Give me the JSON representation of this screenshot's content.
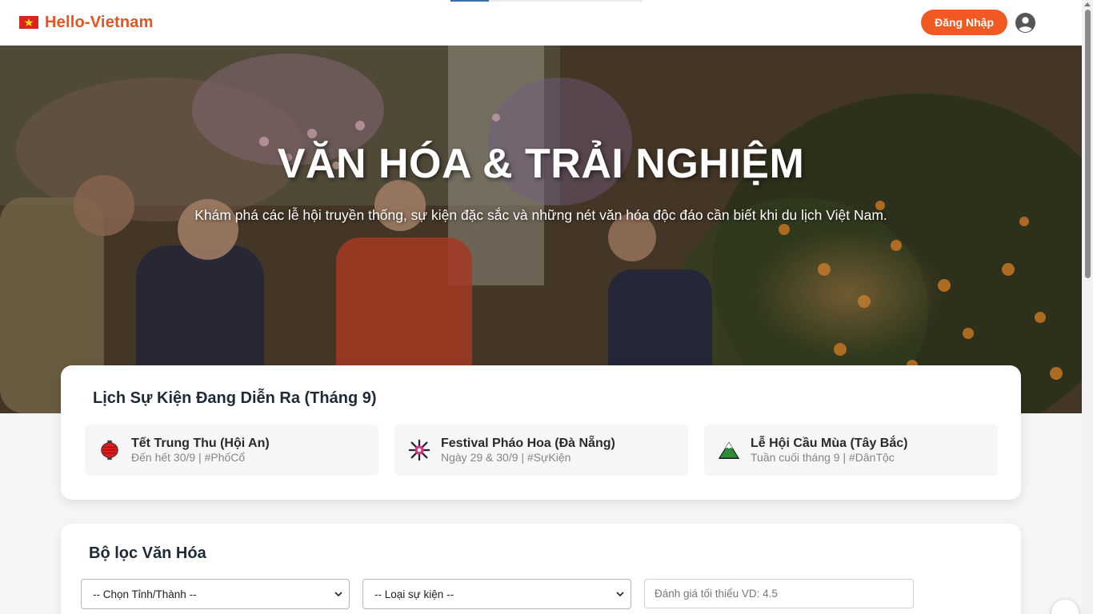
{
  "brand": {
    "name": "Hello-Vietnam",
    "flag_icon": "vietnam-flag-icon",
    "color": "#e8531f"
  },
  "header": {
    "login_label": "Đăng Nhập",
    "login_color": "#f05a22",
    "user_icon": "user-account-icon"
  },
  "hero": {
    "title": "VĂN HÓA & TRẢI NGHIỆM",
    "subtitle": "Khám phá các lễ hội truyền thống, sự kiện đặc sắc và những nét văn hóa độc đáo cần biết khi du lịch Việt Nam."
  },
  "events": {
    "title": "Lịch Sự Kiện Đang Diễn Ra (Tháng 9)",
    "items": [
      {
        "icon": "red-lantern-icon",
        "name": "Tết Trung Thu (Hội An)",
        "meta": "Đến hết 30/9 | #PhốCổ"
      },
      {
        "icon": "fireworks-icon",
        "name": "Festival Pháo Hoa (Đà Nẵng)",
        "meta": "Ngày 29 & 30/9 | #SựKiện"
      },
      {
        "icon": "mountain-icon",
        "name": "Lễ Hội Cầu Mùa (Tây Bắc)",
        "meta": "Tuần cuối tháng 9 | #DânTộc"
      }
    ]
  },
  "filters": {
    "title": "Bộ lọc Văn Hóa",
    "province_select": "-- Chọn Tỉnh/Thành --",
    "event_type_select": "-- Loại sự kiện --",
    "rating_placeholder": "Đánh giá tối thiểu VD: 4.5"
  }
}
